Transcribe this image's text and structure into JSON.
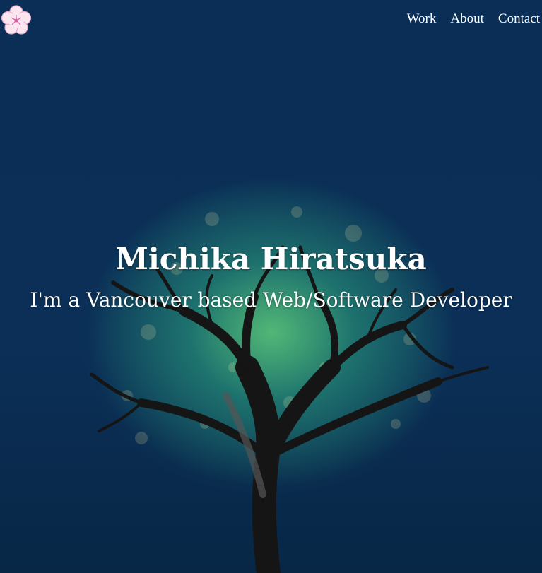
{
  "nav": {
    "items": [
      "Work",
      "About",
      "Contact"
    ]
  },
  "hero": {
    "name": "Michika Hiratsuka",
    "tagline": "I'm a Vancouver based Web/Software Developer"
  },
  "icons": {
    "logo": "plum-blossom-icon"
  },
  "colors": {
    "background": "#0b2f57",
    "glow": "#5cc878",
    "text": "#ffffff",
    "blossom": "#f4c6dd"
  }
}
